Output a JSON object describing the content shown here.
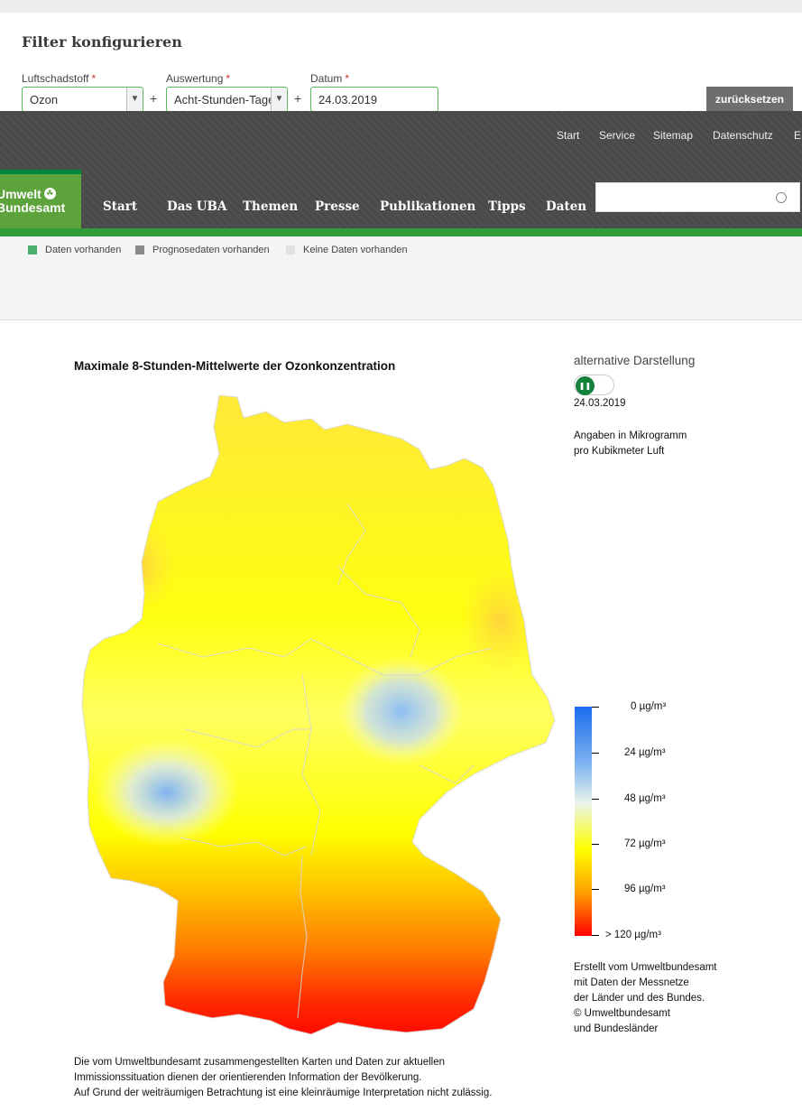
{
  "filter": {
    "title": "Filter konfigurieren",
    "pollutant": {
      "label": "Luftschadstoff",
      "value": "Ozon"
    },
    "evaluation": {
      "label": "Auswertung",
      "value": "Acht-Stunden-Tage"
    },
    "date": {
      "label": "Datum",
      "value": "24.03.2019"
    },
    "required_marker": "*",
    "plus": "+",
    "reset_label": "zurücksetzen"
  },
  "service_nav": [
    "Start",
    "Service",
    "Sitemap",
    "Datenschutz",
    "E"
  ],
  "logo": {
    "line1": "Umwelt",
    "line2": "Bundesamt"
  },
  "main_nav": [
    "Start",
    "Das UBA",
    "Themen",
    "Presse",
    "Publikationen",
    "Tipps",
    "Daten"
  ],
  "search": {
    "placeholder": ""
  },
  "legend": {
    "items": [
      {
        "label": "Daten vorhanden",
        "color": "#4caf70"
      },
      {
        "label": "Prognosedaten vorhanden",
        "color": "#8a8a8a"
      },
      {
        "label": "Keine Daten vorhanden",
        "color": "#e0e0e0"
      }
    ]
  },
  "map": {
    "title": "Maximale 8-Stunden-Mittelwerte der Ozonkonzentration",
    "alt_label": "alternative Darstellung",
    "date": "24.03.2019",
    "units_line1": "Angaben in Mikrogramm",
    "units_line2": "pro Kubikmeter Luft",
    "scale_labels": [
      "0 µg/m³",
      "24 µg/m³",
      "48 µg/m³",
      "72 µg/m³",
      "96 µg/m³",
      "> 120 µg/m³"
    ],
    "scale_colors": [
      "#1a6cf0",
      "#7fb3f0",
      "#eaf4ea",
      "#ffff00",
      "#ff9a00",
      "#ff0000"
    ],
    "credit": [
      "Erstellt vom Umweltbundesamt",
      "mit Daten der Messnetze",
      "der Länder und des Bundes.",
      "© Umweltbundesamt",
      "und Bundesländer"
    ]
  },
  "footnote": [
    "Die vom Umweltbundesamt zusammengestellten Karten und Daten zur aktuellen",
    "Immissionssituation dienen der orientierenden Information der Bevölkerung.",
    "Auf Grund der weiträumigen Betrachtung ist eine kleinräumige Interpretation nicht zulässig."
  ]
}
